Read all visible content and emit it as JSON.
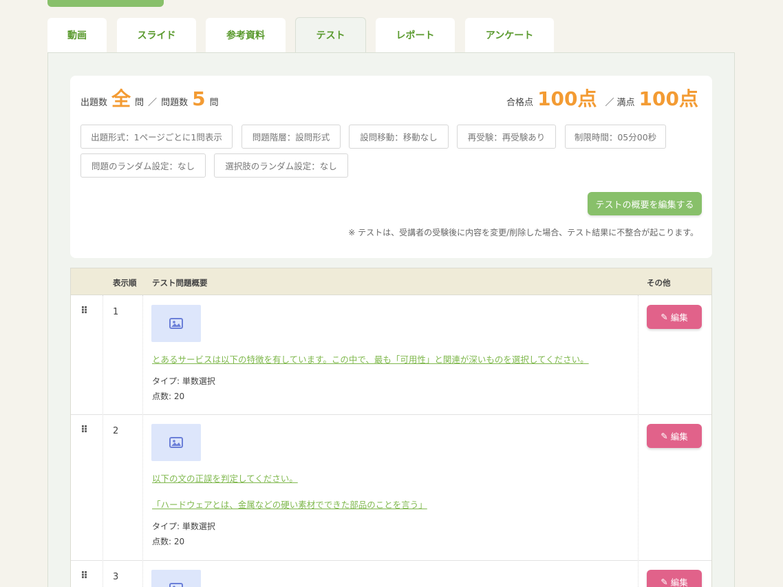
{
  "tabs": [
    "動画",
    "スライド",
    "参考資料",
    "テスト",
    "レポート",
    "アンケート"
  ],
  "summary": {
    "question_count_label": "出題数",
    "question_count_value": "全",
    "question_unit": "問",
    "separator": "／",
    "total_label": "問題数",
    "total_value": "5",
    "pass_label": "合格点",
    "pass_value": "100点",
    "full_label": "満点",
    "full_value": "100点"
  },
  "chips": [
    "出題形式：1ページごとに1問表示",
    "問題階層：設問形式",
    "設問移動：移動なし",
    "再受験：再受験あり",
    "制限時間：05分00秒",
    "問題のランダム設定：なし",
    "選択肢のランダム設定：なし"
  ],
  "edit_overview_label": "テストの概要を編集する",
  "note": "※ テストは、受講者の受験後に内容を変更/削除した場合、テスト結果に不整合が起こります。",
  "table": {
    "headers": [
      "表示順",
      "テスト問題概要",
      "その他"
    ],
    "rows": [
      {
        "order": "1",
        "lines": [
          "とあるサービスは以下の特徴を有しています。この中で、最も「可用性」と関連が深いものを選択してください。"
        ],
        "type": "タイプ: 単数選択",
        "points": "点数: 20"
      },
      {
        "order": "2",
        "lines": [
          "以下の文の正誤を判定してください。",
          "「ハードウェアとは、金属などの硬い素材でできた部品のことを言う」"
        ],
        "type": "タイプ: 単数選択",
        "points": "点数: 20"
      },
      {
        "order": "3",
        "lines": [],
        "type": "",
        "points": ""
      }
    ],
    "edit_label": "編集"
  },
  "colors": {
    "accent_green": "#88c06a",
    "link_green": "#7fb84d",
    "orange": "#f39b33",
    "pink": "#e1628a"
  },
  "icons": {
    "drag": "drag-handle-icon",
    "image": "image-placeholder-icon",
    "edit": "pencil-icon"
  }
}
